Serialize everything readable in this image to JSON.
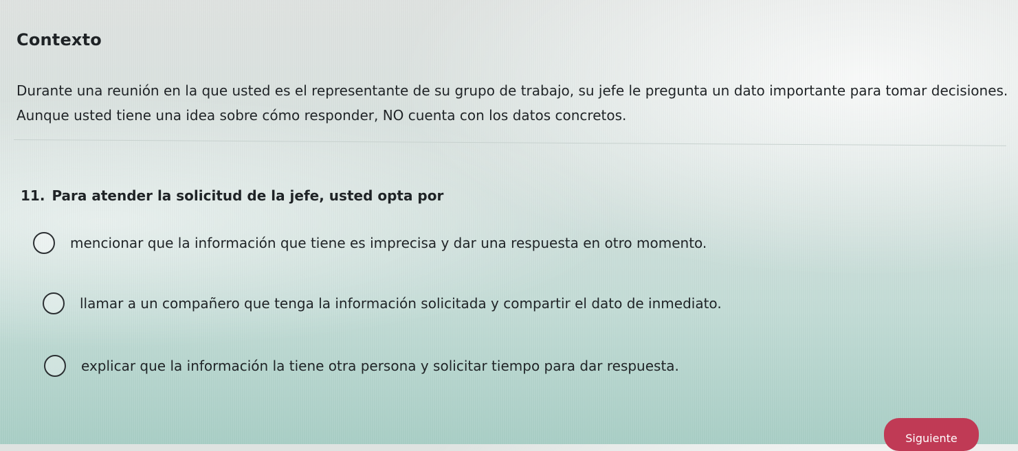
{
  "context": {
    "title": "Contexto",
    "text": "Durante una reunión en la que usted es el representante de su grupo de trabajo, su jefe le pregunta un dato importante para tomar decisiones. Aunque usted tiene una idea sobre cómo responder, NO cuenta con los datos concretos."
  },
  "question": {
    "number": "11.",
    "text": "Para atender la solicitud de la jefe, usted opta por",
    "options": [
      {
        "label": "mencionar que la información que tiene es imprecisa y dar una respuesta en otro momento."
      },
      {
        "label": "llamar a un compañero que tenga la información solicitada y compartir el dato de inmediato."
      },
      {
        "label": "explicar que la información la tiene otra persona y solicitar tiempo para dar respuesta."
      }
    ]
  },
  "navigation": {
    "next_label": "Siguiente"
  },
  "colors": {
    "accent": "#c03a55"
  }
}
